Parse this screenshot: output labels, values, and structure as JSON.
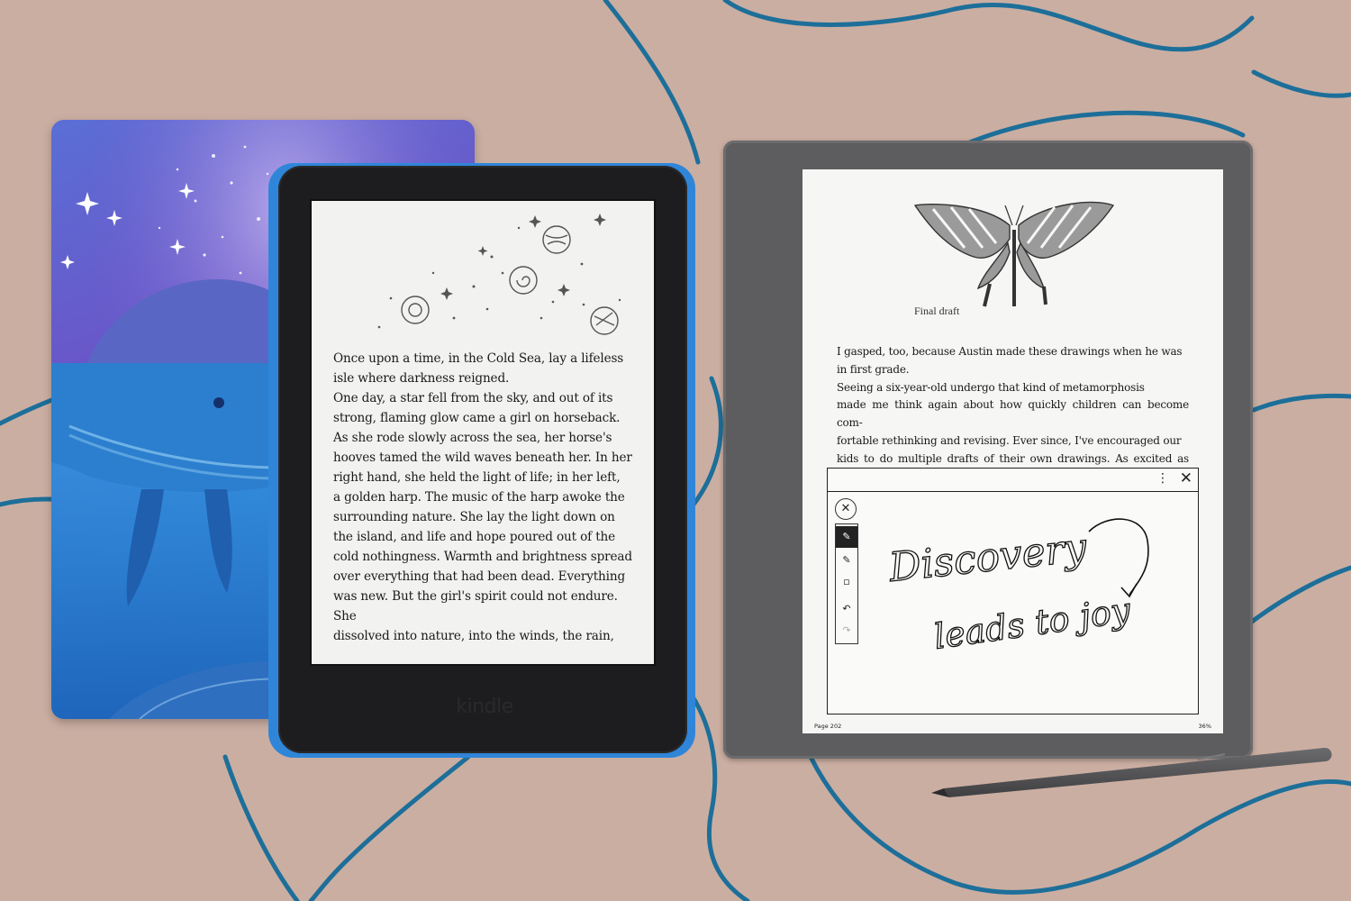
{
  "colors": {
    "background": "#cbaea2",
    "curves": "#1d6f99",
    "bumper": "#2f86d9",
    "kindle_body": "#1d1d1f",
    "scribe_body": "#5d5d5f"
  },
  "kindle": {
    "logo": "kindle",
    "story": "Once upon a time, in the Cold Sea, lay a lifeless\nisle where darkness reigned.\n      One day, a star fell from the sky, and out of its\nstrong, flaming glow came a girl on horseback.\nAs she rode slowly across the sea, her horse's\nhooves tamed the wild waves beneath her. In her\nright hand, she held the light of life; in her left,\na golden harp. The music of the harp awoke the\nsurrounding nature. She lay the light down on\nthe island, and life and hope poured out of the\ncold nothingness. Warmth and brightness spread\nover everything that had been dead. Everything\nwas new. But the girl's spirit could not endure. She\ndissolved into nature, into the winds, the rain,"
  },
  "scribe": {
    "caption": "Final draft",
    "body_text": "      I gasped, too, because Austin made these drawings when he was\nin first grade.\n      Seeing a six-year-old undergo that kind of metamorphosis\nmade me think again about how quickly children can become com-\nfortable rethinking and revising. Ever since, I've encouraged our\nkids to do multiple drafts of their own drawings. As excited as they\nwere to see their first draft hanging on the wall, they're that much",
    "note": {
      "more_icon": "⋮",
      "close_icon": "✕",
      "tool_close_icon": "✕",
      "handwriting_line1": "Discovery",
      "handwriting_line2": "leads to joy"
    },
    "page_label": "Page 202",
    "progress": "36%"
  }
}
